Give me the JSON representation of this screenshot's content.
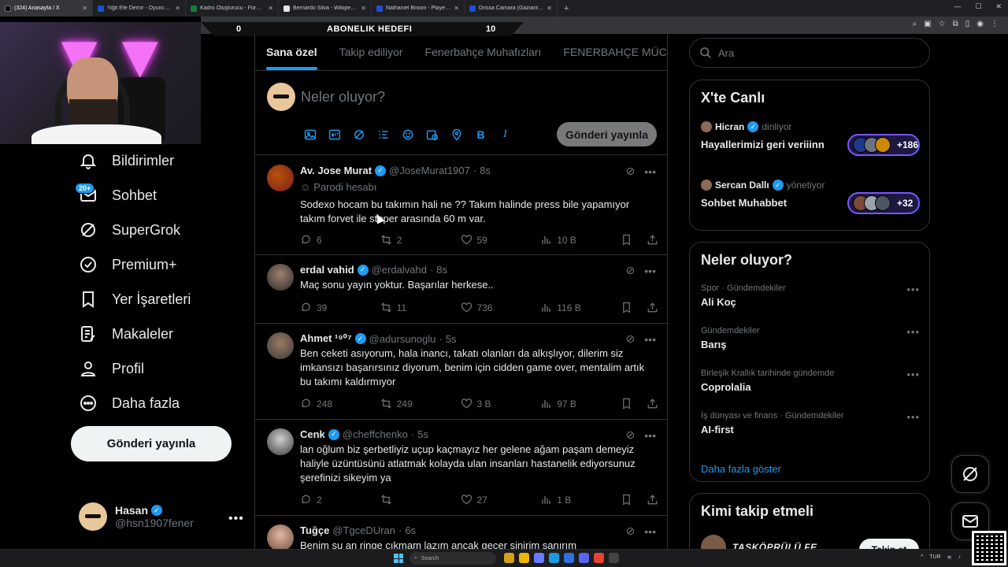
{
  "browser": {
    "tabs": [
      {
        "label": "(324) Anasayfa / X",
        "icon": "x-logo"
      },
      {
        "label": "Yiğit Efe Demir - Oyuncu profili",
        "icon": "site-logo"
      },
      {
        "label": "Kadro Oluşturucu - Formasyon",
        "icon": "site-logo"
      },
      {
        "label": "Bernardo Silva - Wikipedia",
        "icon": "wikipedia-logo"
      },
      {
        "label": "Nathaniel Brown - Player profile",
        "icon": "site-logo"
      },
      {
        "label": "Drissa Camara (Gaziantep FK) ...",
        "icon": "site-logo"
      }
    ],
    "new_tab": "+"
  },
  "overlay": {
    "left_value": "0",
    "goal_label": "ABONELIK HEDEFI",
    "right_value": "10"
  },
  "nav": {
    "items": [
      {
        "label": "Bildirimler",
        "icon": "bell-icon"
      },
      {
        "label": "Sohbet",
        "icon": "envelope-icon",
        "badge": "20+"
      },
      {
        "label": "SuperGrok",
        "icon": "grok-icon"
      },
      {
        "label": "Premium+",
        "icon": "verified-badge-icon"
      },
      {
        "label": "Yer İşaretleri",
        "icon": "bookmark-icon"
      },
      {
        "label": "Makaleler",
        "icon": "article-icon"
      },
      {
        "label": "Profil",
        "icon": "person-icon"
      },
      {
        "label": "Daha fazla",
        "icon": "more-circle-icon"
      }
    ],
    "post_button": "Gönderi yayınla",
    "account": {
      "name": "Hasan",
      "handle": "@hsn1907fener",
      "more": "•••"
    }
  },
  "feed": {
    "tabs": [
      "Sana özel",
      "Takip ediliyor",
      "Fenerbahçe Muhafızları",
      "FENERBAHÇE MÜCADE"
    ],
    "active_tab": "Sana özel",
    "compose": {
      "placeholder": "Neler oluyor?",
      "post_button": "Gönderi yayınla",
      "format_bold": "B",
      "format_italic": "I"
    },
    "tweets": [
      {
        "name": "Av. Jose Murat",
        "handle": "@JoseMurat1907",
        "time": "8s",
        "label": "Parodi hesabı",
        "text": "Sodexo hocam bu takımın hali ne ?? Takım halinde press bile yapamıyor takım forvet ile stoper arasında 60 m var.",
        "replies": "6",
        "reposts": "2",
        "likes": "59",
        "views": "10 B"
      },
      {
        "name": "erdal vahid",
        "handle": "@erdalvahd",
        "time": "8s",
        "text": "Maç sonu yayın yoktur. Başarılar herkese..",
        "replies": "39",
        "reposts": "11",
        "likes": "736",
        "views": "116 B"
      },
      {
        "name": "Ahmet ¹⁹⁰⁷",
        "handle": "@adursunoglu",
        "time": "5s",
        "text": "Ben ceketi asıyorum, hala inancı, takatı olanları da alkışlıyor, dilerim siz imkansızı başarırsınız diyorum, benim için cidden game over, mentalim artık bu takımı kaldırmıyor",
        "replies": "248",
        "reposts": "249",
        "likes": "3 B",
        "views": "97 B"
      },
      {
        "name": "Cenk",
        "handle": "@cheffchenko",
        "time": "5s",
        "text": "lan oğlum biz şerbetliyiz uçup kaçmayız her gelene ağam paşam demeyiz haliyle üzüntüsünü atlatmak kolayda ulan insanları hastanelik ediyorsunuz şerefinizi sikeyim ya",
        "replies": "2",
        "reposts": "",
        "likes": "27",
        "views": "1 B"
      },
      {
        "name": "Tuğçe",
        "handle": "@TgceDUran",
        "time": "6s",
        "text": "Benim şu an ringe çıkmam lazım ancak geçer sinirim sanırım"
      }
    ]
  },
  "sidebar": {
    "search_placeholder": "Ara",
    "live": {
      "title": "X'te Canlı",
      "items": [
        {
          "host": "Hicran",
          "status": "dinliyor",
          "title": "Hayallerimizi geri veriiinn",
          "count": "+186"
        },
        {
          "host": "Sercan Dallı",
          "status": "yönetiyor",
          "title": "Sohbet Muhabbet",
          "count": "+32"
        }
      ]
    },
    "trends": {
      "title": "Neler oluyor?",
      "items": [
        {
          "category": "Spor · Gündemdekiler",
          "topic": "Ali Koç"
        },
        {
          "category": "Gündemdekiler",
          "topic": "Barış"
        },
        {
          "category": "Birleşik Krallık tarihinde gündemde",
          "topic": "Coprolalia"
        },
        {
          "category": "İş dünyası ve finans · Gündemdekiler",
          "topic": "AI-first"
        }
      ],
      "show_more": "Daha fazla göster"
    },
    "who_to_follow": {
      "title": "Kimi takip etmeli",
      "name": "TAŞKÖPRÜLÜ FE...",
      "button": "Takip et"
    }
  },
  "taskbar": {
    "search": "Search",
    "lang": "TUR"
  },
  "colors": {
    "accent": "#1d9bf0",
    "background": "#000000",
    "border": "#2f3336",
    "muted": "#71767b",
    "live_ring": "#7856ff"
  }
}
